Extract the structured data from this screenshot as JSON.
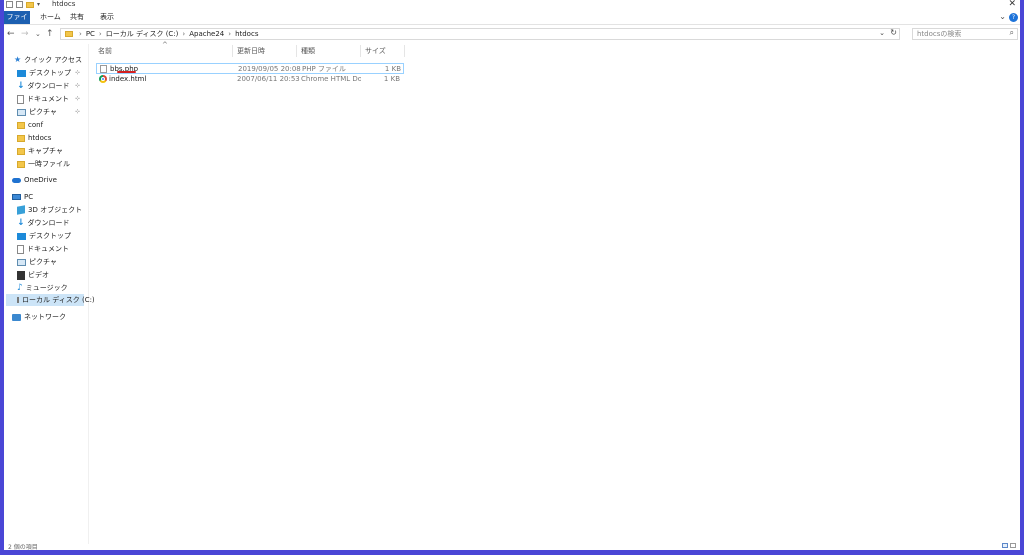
{
  "window": {
    "title": "htdocs",
    "close_glyph": "✕"
  },
  "ribbon": {
    "tabs": [
      "ファイル",
      "ホーム",
      "共有",
      "表示"
    ],
    "help": "?"
  },
  "address_bar": {
    "back": "←",
    "forward": "→",
    "recent": "⌄",
    "up": "↑",
    "crumbs": [
      "PC",
      "ローカル ディスク (C:)",
      "Apache24",
      "htdocs"
    ],
    "separator": "›",
    "dropdown": "⌄",
    "refresh": "↻"
  },
  "search": {
    "placeholder": "htdocsの検索",
    "icon": "search-icon"
  },
  "nav_pane": {
    "quick_access": {
      "label": "クイック アクセス",
      "items": [
        {
          "label": "デスクトップ",
          "icon": "desktop-icon",
          "pinned": true
        },
        {
          "label": "ダウンロード",
          "icon": "download-icon",
          "pinned": true
        },
        {
          "label": "ドキュメント",
          "icon": "document-icon",
          "pinned": true
        },
        {
          "label": "ピクチャ",
          "icon": "picture-icon",
          "pinned": true
        },
        {
          "label": "conf",
          "icon": "folder-icon",
          "pinned": false
        },
        {
          "label": "htdocs",
          "icon": "folder-icon",
          "pinned": false
        },
        {
          "label": "キャプチャ",
          "icon": "folder-icon",
          "pinned": false
        },
        {
          "label": "一時ファイル",
          "icon": "folder-icon",
          "pinned": false
        }
      ]
    },
    "onedrive": {
      "label": "OneDrive"
    },
    "pc": {
      "label": "PC",
      "items": [
        {
          "label": "3D オブジェクト",
          "icon": "3d-objects-icon"
        },
        {
          "label": "ダウンロード",
          "icon": "download-icon"
        },
        {
          "label": "デスクトップ",
          "icon": "desktop-icon"
        },
        {
          "label": "ドキュメント",
          "icon": "document-icon"
        },
        {
          "label": "ピクチャ",
          "icon": "picture-icon"
        },
        {
          "label": "ビデオ",
          "icon": "video-icon"
        },
        {
          "label": "ミュージック",
          "icon": "music-icon"
        },
        {
          "label": "ローカル ディスク (C:)",
          "icon": "drive-icon",
          "selected": true
        }
      ]
    },
    "network": {
      "label": "ネットワーク"
    },
    "pin_glyph": "📌"
  },
  "file_list": {
    "columns": {
      "name": "名前",
      "date": "更新日時",
      "type": "種類",
      "size": "サイズ"
    },
    "sort_indicator": "^",
    "rows": [
      {
        "name": "bbs.php",
        "date": "2019/09/05 20:08",
        "type": "PHP ファイル",
        "size": "1 KB",
        "icon": "php-file-icon",
        "selected": true
      },
      {
        "name": "index.html",
        "date": "2007/06/11 20:53",
        "type": "Chrome HTML Do...",
        "size": "1 KB",
        "icon": "chrome-html-icon",
        "selected": false
      }
    ]
  },
  "status_bar": {
    "item_count": "2 個の項目"
  },
  "colors": {
    "frame": "#4a46d6",
    "file_tab": "#1c5fb0",
    "selection": "#cce4f7",
    "annotation_underline": "#d32020"
  }
}
